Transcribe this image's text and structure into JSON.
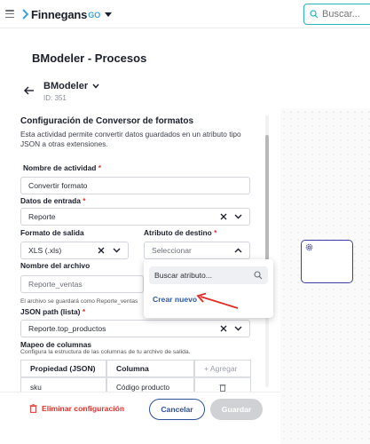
{
  "header": {
    "brand": "Finnegans",
    "brand_suffix": "GO",
    "search_placeholder": "Buscar..."
  },
  "page": {
    "title": "BModeler - Procesos",
    "process_name": "BModeler",
    "process_id": "ID: 351"
  },
  "form": {
    "section_title": "Configuración de Conversor de formatos",
    "description": "Esta actividad permite convertir datos guardados en un atributo tipo JSON a otras extensiones.",
    "activity_name_label": "Nombre de actividad",
    "activity_name_value": "Convertir formato",
    "input_data_label": "Datos de entrada",
    "input_data_value": "Reporte",
    "output_format_label": "Formato de salida",
    "output_format_value": "XLS (.xls)",
    "dest_attr_label": "Atributo de destino",
    "dest_attr_placeholder": "Seleccionar",
    "file_name_label": "Nombre del archivo",
    "file_name_value": "Reporte_ventas",
    "file_note": "El archivo se guardará como Reporte_ventas",
    "json_path_label": "JSON path (lista)",
    "json_path_value": "Reporte.top_productos",
    "mapping_title": "Mapeo de columnas",
    "mapping_desc": "Configura la estructura de las columnas de tu archivo de salida.",
    "required_mark": "*"
  },
  "dropdown": {
    "search_placeholder": "Buscar atributo...",
    "create_new": "Crear nuevo"
  },
  "table": {
    "headers": [
      "Propiedad (JSON)",
      "Columna",
      "+ Agregar"
    ],
    "rows": [
      {
        "property": "sku",
        "column": "Código producto"
      }
    ]
  },
  "footer": {
    "delete_label": "Eliminar configuración",
    "cancel_label": "Cancelar",
    "save_label": "Guardar"
  },
  "colors": {
    "accent": "#2f4f9a",
    "danger": "#e5322d",
    "link": "#2f5aa8",
    "search_border": "#2bb3c0",
    "node_border": "#3b3ea8"
  }
}
